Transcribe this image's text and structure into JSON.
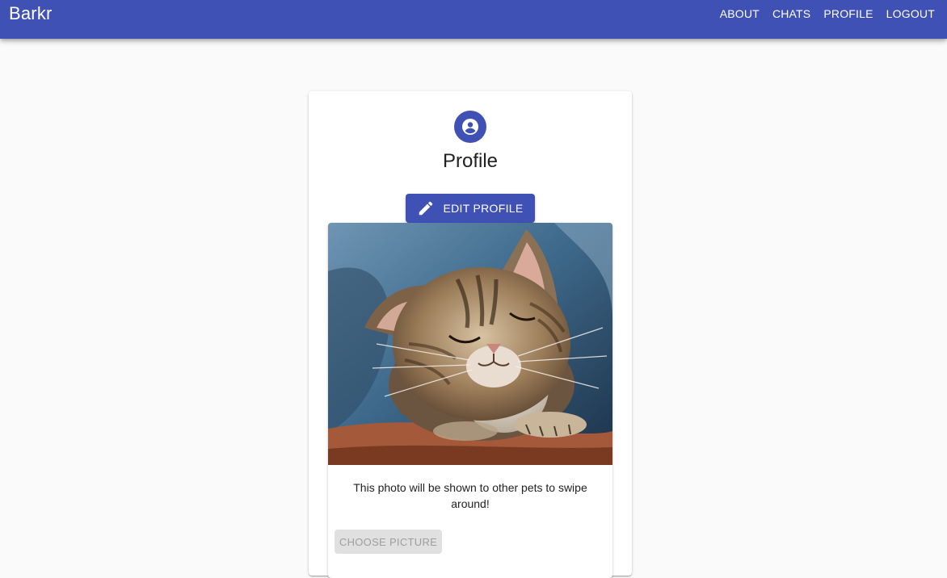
{
  "app": {
    "brand": "Barkr"
  },
  "nav": {
    "items": [
      {
        "label": "ABOUT"
      },
      {
        "label": "CHATS"
      },
      {
        "label": "PROFILE"
      },
      {
        "label": "LOGOUT"
      }
    ]
  },
  "profile": {
    "avatar_icon": "account-circle-icon",
    "title": "Profile",
    "edit_button": {
      "label": "EDIT PROFILE",
      "icon": "pencil-icon"
    },
    "photo": {
      "subject": "kitten"
    },
    "caption": "This photo will be shown to other pets to swipe around!",
    "choose_button": {
      "label": "CHOOSE PICTURE",
      "disabled": true
    }
  },
  "colors": {
    "primary": "#3f51b5",
    "background": "#fafafa",
    "disabled_bg": "#e0e0e0",
    "disabled_text": "#9e9e9e"
  }
}
